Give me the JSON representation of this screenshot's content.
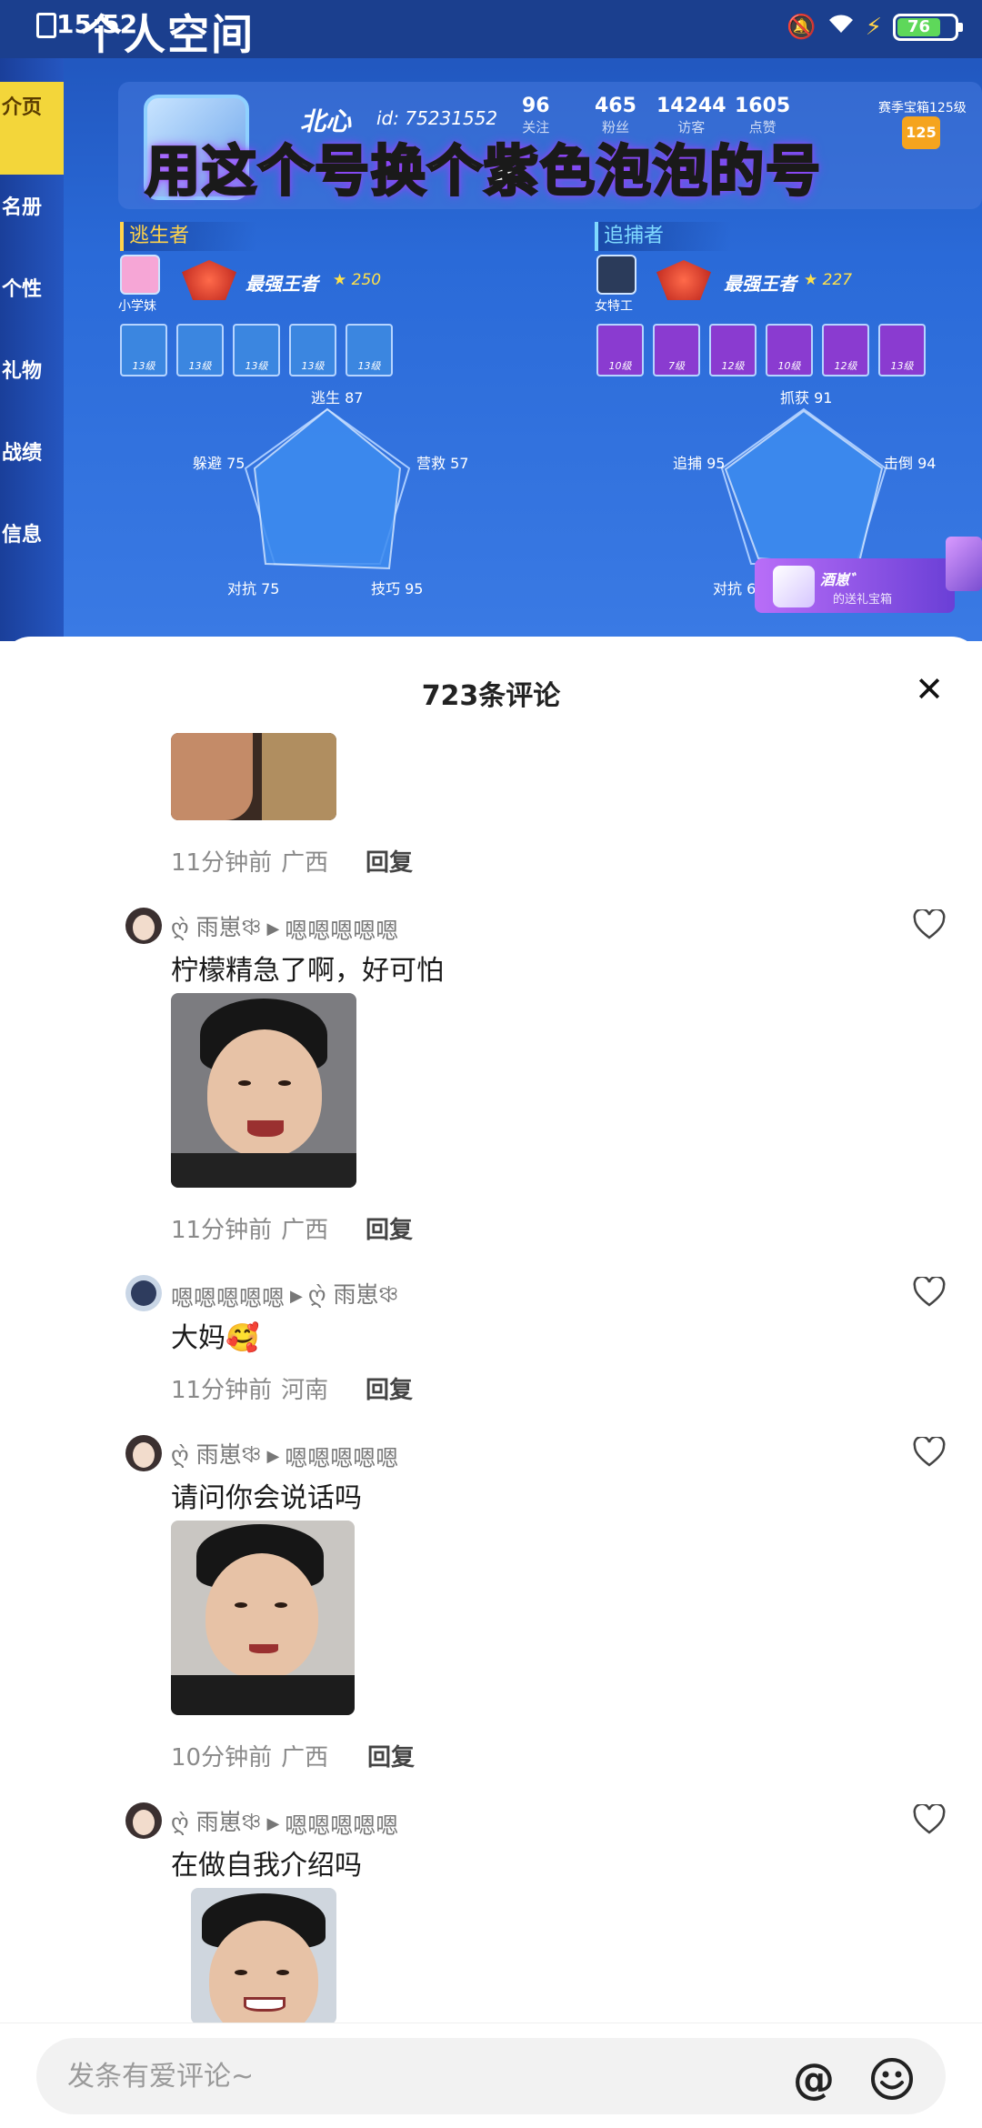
{
  "status_bar": {
    "time": "15:52",
    "battery": "76"
  },
  "game": {
    "page_title": "个人空间",
    "side_nav": [
      "介页",
      "名册",
      "个性",
      "礼物",
      "战绩",
      "信息"
    ],
    "nickname": "北心",
    "player_id": "id: 75231552",
    "stats": [
      {
        "value": "96",
        "label": "关注"
      },
      {
        "value": "465",
        "label": "粉丝"
      },
      {
        "value": "14244",
        "label": "访客"
      },
      {
        "value": "1605",
        "label": "点赞"
      }
    ],
    "season_label": "赛季宝箱125级",
    "season_level": "125",
    "overlay_caption": "用这个号换个紫色泡泡的号",
    "escaper": {
      "section_label": "逃生者",
      "character_name": "小学妹",
      "rank_title": "最强王者",
      "rank_stars": "250",
      "skill_levels": [
        "13级",
        "13级",
        "13级",
        "13级",
        "13级"
      ],
      "radar_labels": [
        "逃生 87",
        "营救 57",
        "技巧 95",
        "对抗 75",
        "躲避 75"
      ]
    },
    "hunter": {
      "section_label": "追捕者",
      "character_name": "女特工",
      "rank_title": "最强王者",
      "rank_stars": "227",
      "skill_levels": [
        "10级",
        "7级",
        "12级",
        "10级",
        "12级",
        "13级"
      ],
      "radar_labels": [
        "抓获 91",
        "击倒 94",
        "对抗 67",
        "追捕 95"
      ]
    },
    "gift_banner": {
      "name": "酒崽゛",
      "subtitle": "的送礼宝箱"
    }
  },
  "comments_sheet": {
    "title": "723条评论",
    "close_label": "✕",
    "reply_label": "回复",
    "comments": [
      {
        "username": "",
        "reply_to": "",
        "text": "",
        "time": "11分钟前",
        "location": "广西"
      },
      {
        "username": "ღ̀ 雨崽ঞ্চ",
        "reply_to": "嗯嗯嗯嗯嗯",
        "text": "柠檬精急了啊，好可怕",
        "time": "11分钟前",
        "location": "广西"
      },
      {
        "username": "嗯嗯嗯嗯嗯",
        "reply_to": "ღ̀ 雨崽ঞ্চ",
        "text": "大妈🥰",
        "time": "11分钟前",
        "location": "河南"
      },
      {
        "username": "ღ̀ 雨崽ঞ্চ",
        "reply_to": "嗯嗯嗯嗯嗯",
        "text": "请问你会说话吗",
        "time": "10分钟前",
        "location": "广西"
      },
      {
        "username": "ღ̀ 雨崽ঞ্চ",
        "reply_to": "嗯嗯嗯嗯嗯",
        "text": "在做自我介绍吗",
        "time": "",
        "location": ""
      }
    ]
  },
  "input_bar": {
    "placeholder": "发条有爱评论~",
    "at_icon": "@"
  },
  "colors": {
    "game_blue": "#2a6ad8",
    "accent_yellow": "#f3d63a",
    "caption_glow": "#a63cff"
  }
}
